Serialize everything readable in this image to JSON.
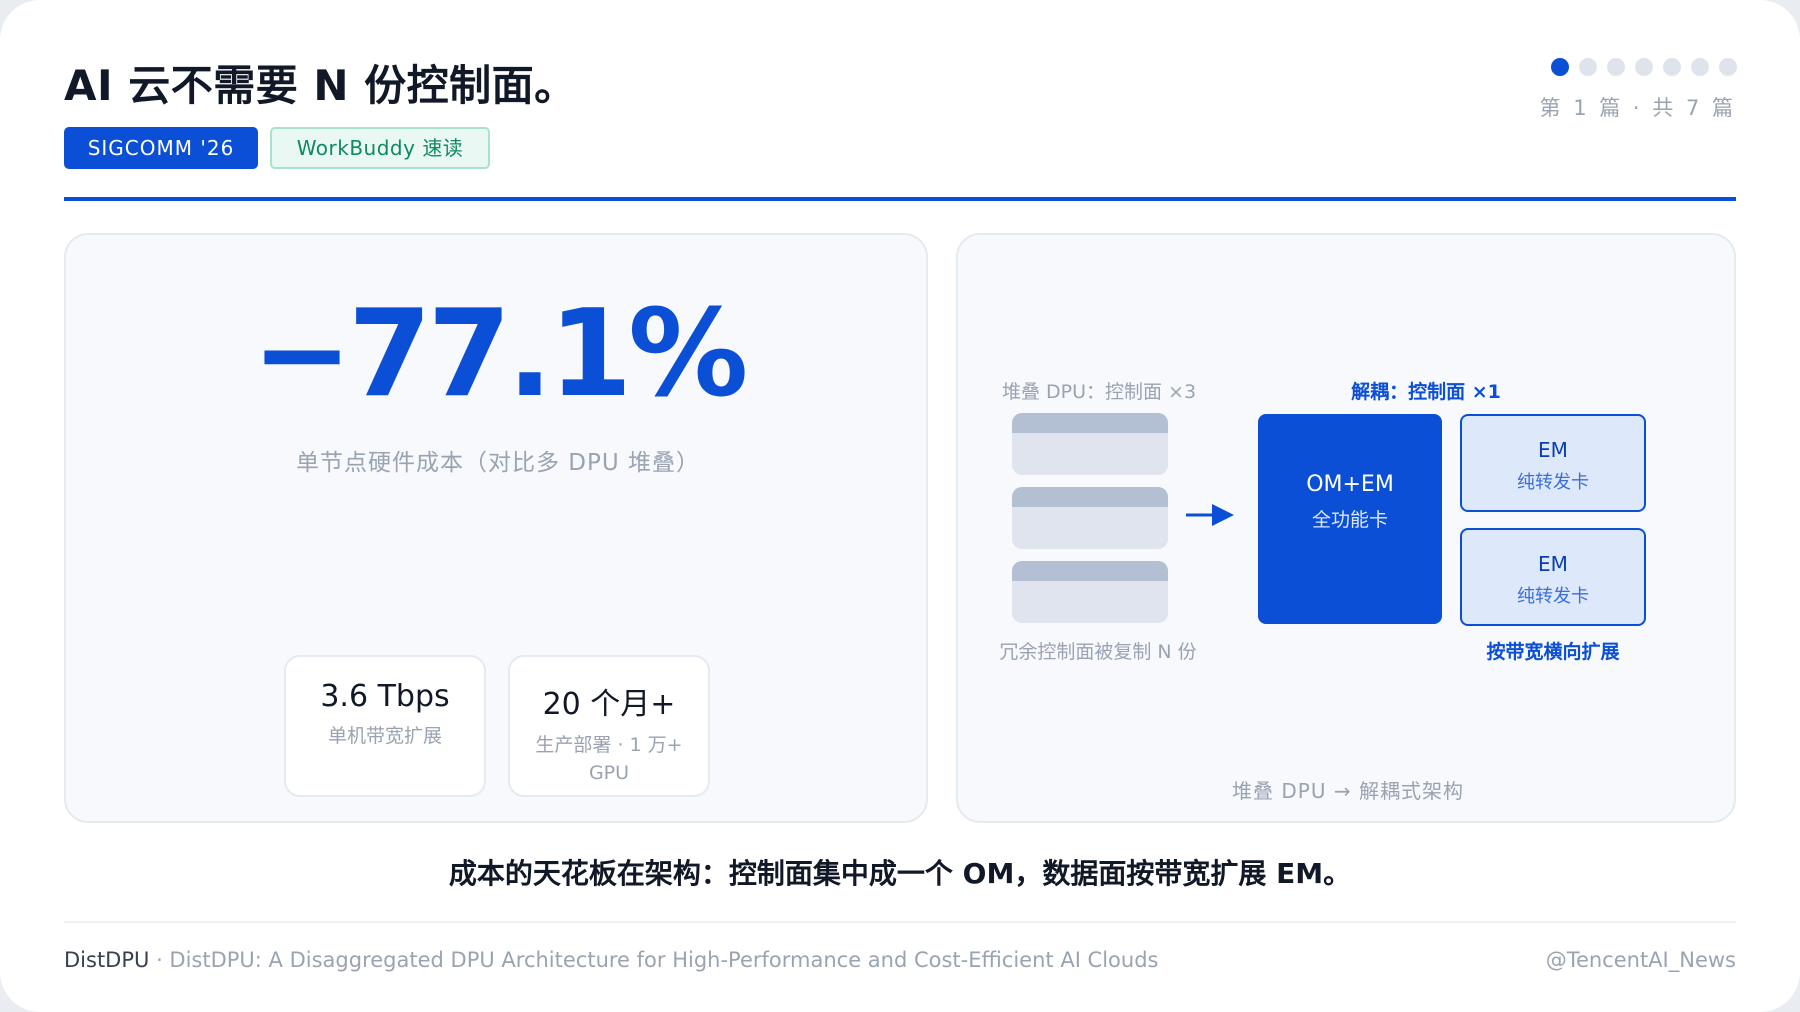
{
  "header": {
    "title": "AI 云不需要 N 份控制面。",
    "badges": [
      "SIGCOMM '26",
      "WorkBuddy 速读"
    ],
    "page_indicator": "第 1 篇 · 共 7 篇",
    "pagination": {
      "current": 1,
      "total": 7
    }
  },
  "metric_card": {
    "value": "−77.1%",
    "caption": "单节点硬件成本（对比多 DPU 堆叠）",
    "stats": [
      {
        "value": "3.6 Tbps",
        "label": "单机带宽扩展"
      },
      {
        "value": "20 个月+",
        "label": "生产部署 · 1 万+ GPU"
      }
    ]
  },
  "diagram": {
    "stacked_label": "堆叠 DPU：控制面 ×3",
    "decoupled_label": "解耦：控制面 ×1",
    "om_box": {
      "title": "OM+EM",
      "subtitle": "全功能卡"
    },
    "em_boxes": [
      {
        "title": "EM",
        "subtitle": "纯转发卡"
      },
      {
        "title": "EM",
        "subtitle": "纯转发卡"
      }
    ],
    "redundant_label": "冗余控制面被复制 N 份",
    "scale_label": "按带宽横向扩展",
    "caption": "堆叠 DPU → 解耦式架构"
  },
  "summary": "成本的天花板在架构：控制面集中成一个 OM，数据面按带宽扩展 EM。",
  "footer": {
    "brand": "DistDPU",
    "separator": " · ",
    "paper_title": "DistDPU: A Disaggregated DPU Architecture for High-Performance and Cost-Efficient AI Clouds",
    "handle": "@TencentAI_News"
  },
  "colors": {
    "accent": "#0b4fd6",
    "badge_secondary_text": "#0f8a5f",
    "muted_text": "#9aa3b2",
    "em_fill": "#dde8fb"
  },
  "icons": {
    "arrow": "arrow-right-icon"
  }
}
